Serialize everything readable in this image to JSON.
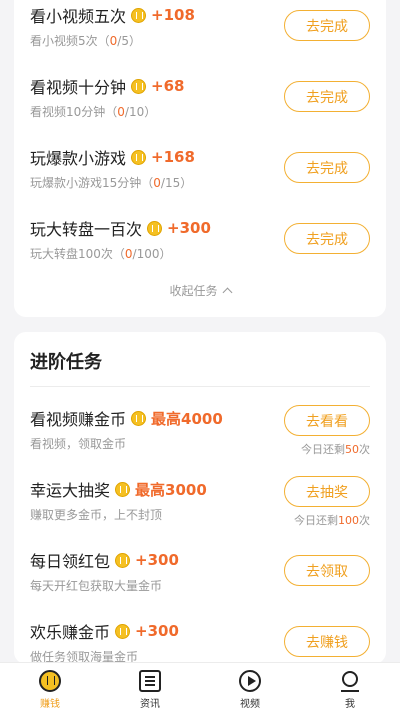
{
  "basic_tasks": [
    {
      "name": "看小视频五次",
      "reward": "+108",
      "sub_prefix": "看小视频5次（",
      "progress": "0",
      "sub_suffix": "/5）",
      "button": "去完成"
    },
    {
      "name": "看视频十分钟",
      "reward": "+68",
      "sub_prefix": "看视频10分钟（",
      "progress": "0",
      "sub_suffix": "/10）",
      "button": "去完成"
    },
    {
      "name": "玩爆款小游戏",
      "reward": "+168",
      "sub_prefix": "玩爆款小游戏15分钟（",
      "progress": "0",
      "sub_suffix": "/15）",
      "button": "去完成"
    },
    {
      "name": "玩大转盘一百次",
      "reward": "+300",
      "sub_prefix": "玩大转盘100次（",
      "progress": "0",
      "sub_suffix": "/100）",
      "button": "去完成"
    }
  ],
  "collapse_label": "收起任务",
  "advanced_section": {
    "title": "进阶任务",
    "tasks": [
      {
        "name": "看视频赚金币",
        "reward": "最高4000",
        "sub": "看视频，领取金币",
        "button": "去看看",
        "remain_prefix": "今日还剩",
        "remain_count": "50",
        "remain_suffix": "次"
      },
      {
        "name": "幸运大抽奖",
        "reward": "最高3000",
        "sub": "赚取更多金币，上不封顶",
        "button": "去抽奖",
        "remain_prefix": "今日还剩",
        "remain_count": "100",
        "remain_suffix": "次"
      },
      {
        "name": "每日领红包",
        "reward": "+300",
        "sub": "每天开红包获取大量金币",
        "button": "去领取"
      },
      {
        "name": "欢乐赚金币",
        "reward": "+300",
        "sub": "做任务领取海量金币",
        "button": "去赚钱"
      }
    ]
  },
  "tabbar": [
    {
      "label": "赚钱",
      "icon": "coin-icon",
      "active": true
    },
    {
      "label": "资讯",
      "icon": "news-icon",
      "active": false
    },
    {
      "label": "视频",
      "icon": "video-play-icon",
      "active": false
    },
    {
      "label": "我",
      "icon": "user-icon",
      "active": false
    }
  ],
  "colors": {
    "accent": "#f0a020",
    "reward": "#f06a2b",
    "coin": "#f5c022"
  }
}
